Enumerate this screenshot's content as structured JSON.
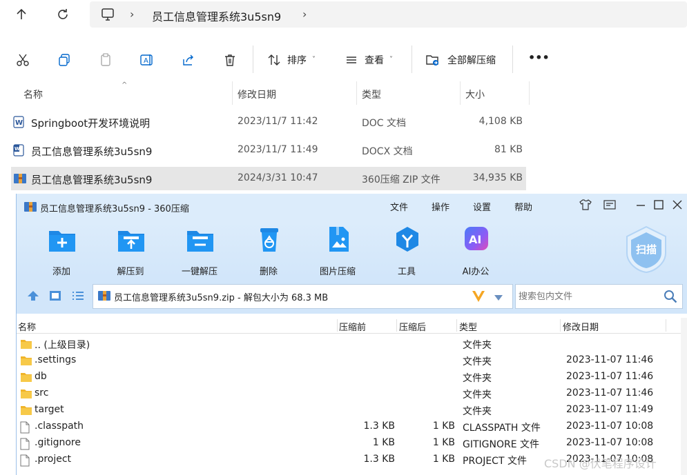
{
  "explorer": {
    "breadcrumb": "员工信息管理系统3u5sn9",
    "toolbar": {
      "sort_label": "排序",
      "view_label": "查看",
      "extract_all_label": "全部解压缩",
      "more_label": "•••"
    },
    "columns": {
      "name": "名称",
      "modified": "修改日期",
      "type": "类型",
      "size": "大小"
    },
    "files": [
      {
        "name": "Springboot开发环境说明",
        "modified": "2023/11/7 11:42",
        "type": "DOC 文档",
        "size": "4,108 KB"
      },
      {
        "name": "员工信息管理系统3u5sn9",
        "modified": "2023/11/7 11:49",
        "type": "DOCX 文档",
        "size": "81 KB"
      },
      {
        "name": "员工信息管理系统3u5sn9",
        "modified": "2024/3/31 10:47",
        "type": "360压缩 ZIP 文件",
        "size": "34,935 KB"
      }
    ]
  },
  "zip": {
    "title": "员工信息管理系统3u5sn9 - 360压缩",
    "menu": [
      "文件",
      "操作",
      "设置",
      "帮助"
    ],
    "tools": [
      {
        "label": "添加"
      },
      {
        "label": "解压到"
      },
      {
        "label": "一键解压"
      },
      {
        "label": "删除"
      },
      {
        "label": "图片压缩"
      },
      {
        "label": "工具"
      },
      {
        "label": "AI办公"
      }
    ],
    "scan_label": "扫描",
    "ai_badge": "AI",
    "path": "员工信息管理系统3u5sn9.zip - 解包大小为 68.3 MB",
    "search_placeholder": "搜索包内文件",
    "columns": {
      "name": "名称",
      "packed": "压缩前",
      "unpacked": "压缩后",
      "type": "类型",
      "modified": "修改日期"
    },
    "rows": [
      {
        "name": ".. (上级目录)",
        "packed": "",
        "unpacked": "",
        "type": "文件夹",
        "modified": "",
        "kind": "folder"
      },
      {
        "name": ".settings",
        "packed": "",
        "unpacked": "",
        "type": "文件夹",
        "modified": "2023-11-07 11:46",
        "kind": "folder"
      },
      {
        "name": "db",
        "packed": "",
        "unpacked": "",
        "type": "文件夹",
        "modified": "2023-11-07 11:46",
        "kind": "folder"
      },
      {
        "name": "src",
        "packed": "",
        "unpacked": "",
        "type": "文件夹",
        "modified": "2023-11-07 11:46",
        "kind": "folder"
      },
      {
        "name": "target",
        "packed": "",
        "unpacked": "",
        "type": "文件夹",
        "modified": "2023-11-07 11:49",
        "kind": "folder"
      },
      {
        "name": ".classpath",
        "packed": "1.3 KB",
        "unpacked": "1 KB",
        "type": "CLASSPATH 文件",
        "modified": "2023-11-07 10:08",
        "kind": "file"
      },
      {
        "name": ".gitignore",
        "packed": "1 KB",
        "unpacked": "1 KB",
        "type": "GITIGNORE 文件",
        "modified": "2023-11-07 10:08",
        "kind": "file"
      },
      {
        "name": ".project",
        "packed": "1.3 KB",
        "unpacked": "1 KB",
        "type": "PROJECT 文件",
        "modified": "2023-11-07 10:08",
        "kind": "file"
      }
    ]
  },
  "watermark": "CSDN @伏笔程序设计"
}
